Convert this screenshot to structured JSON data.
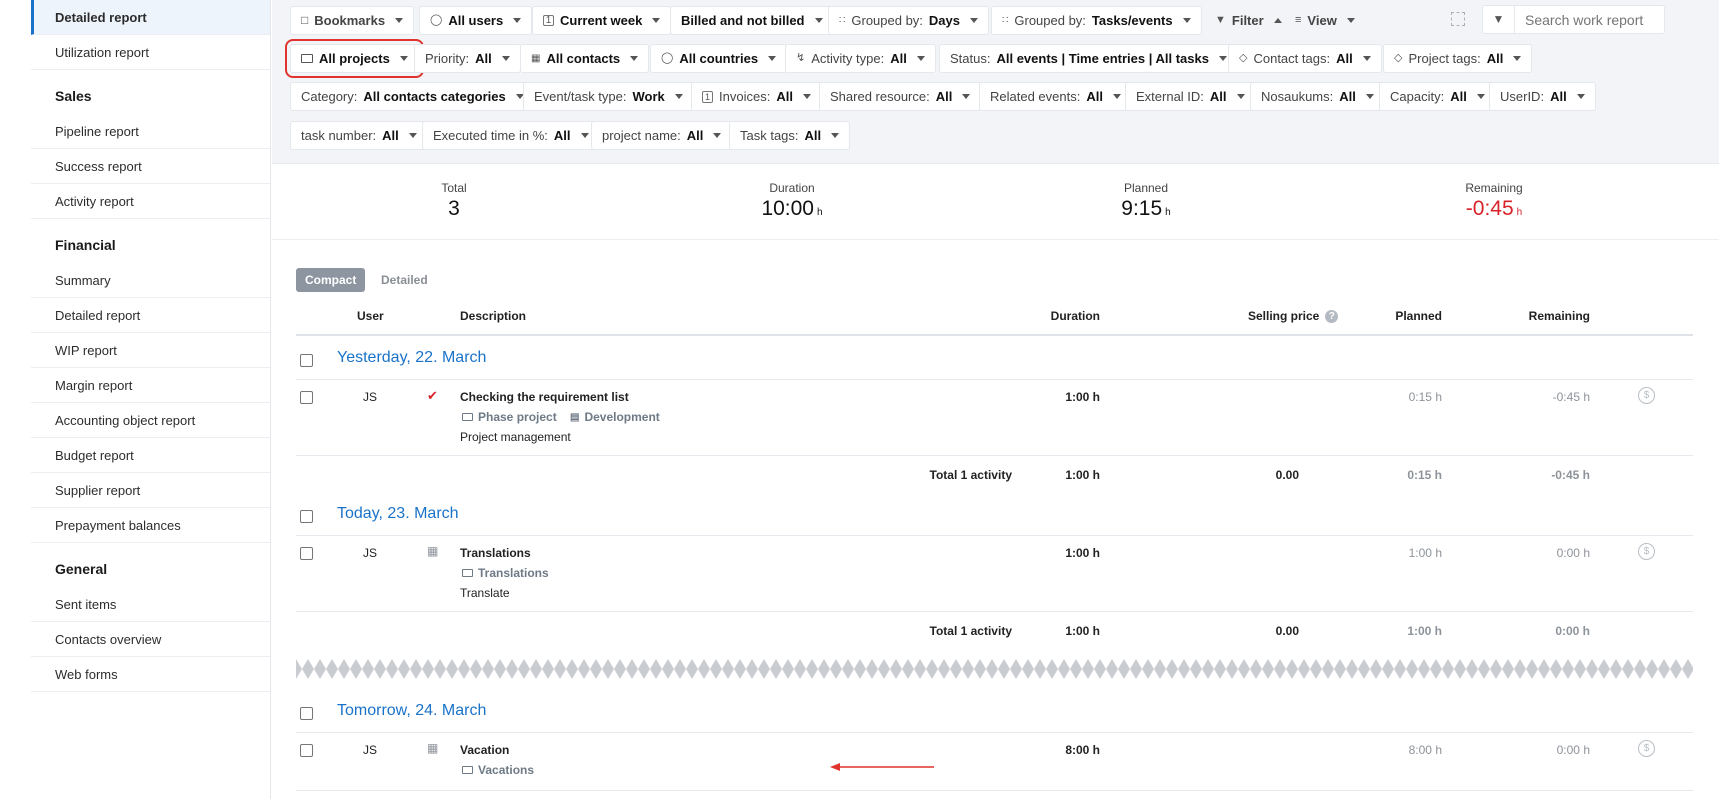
{
  "sidebar": {
    "top_items": [
      "Detailed report",
      "Utilization report"
    ],
    "sales_heading": "Sales",
    "sales_items": [
      "Pipeline report",
      "Success report",
      "Activity report"
    ],
    "financial_heading": "Financial",
    "financial_items": [
      "Summary",
      "Detailed report",
      "WIP report",
      "Margin report",
      "Accounting object report",
      "Budget report",
      "Supplier report",
      "Prepayment balances"
    ],
    "general_heading": "General",
    "general_items": [
      "Sent items",
      "Contacts overview",
      "Web forms"
    ]
  },
  "filters": {
    "row1": {
      "bookmarks": "Bookmarks",
      "users": "All users",
      "period": "Current week",
      "billing": "Billed and not billed",
      "grouped_days_label": "Grouped by: ",
      "grouped_days_value": "Days",
      "grouped_tasks_label": "Grouped by: ",
      "grouped_tasks_value": "Tasks/events",
      "filter": "Filter",
      "view": "View",
      "search_placeholder": "Search work report"
    },
    "row2": {
      "projects": "All projects",
      "priority_label": "Priority: ",
      "priority_value": "All",
      "contacts": "All contacts",
      "countries": "All countries",
      "activity_label": "Activity type: ",
      "activity_value": "All",
      "status_label": "Status: ",
      "status_value": "All events | Time entries | All tasks",
      "contact_tags_label": "Contact tags: ",
      "contact_tags_value": "All",
      "project_tags_label": "Project tags: ",
      "project_tags_value": "All"
    },
    "row3": {
      "category_label": "Category: ",
      "category_value": "All contacts categories",
      "event_type_label": "Event/task type: ",
      "event_type_value": "Work",
      "invoices_label": "Invoices: ",
      "invoices_value": "All",
      "shared_label": "Shared resource: ",
      "shared_value": "All",
      "related_label": "Related events: ",
      "related_value": "All",
      "external_label": "External ID: ",
      "external_value": "All",
      "nosaukums_label": "Nosaukums: ",
      "nosaukums_value": "All",
      "capacity_label": "Capacity: ",
      "capacity_value": "All",
      "userid_label": "UserID: ",
      "userid_value": "All"
    },
    "row4": {
      "task_number_label": "task number: ",
      "task_number_value": "All",
      "executed_label": "Executed time in %: ",
      "executed_value": "All",
      "project_name_label": "project name: ",
      "project_name_value": "All",
      "task_tags_label": "Task tags: ",
      "task_tags_value": "All"
    }
  },
  "summary": {
    "total_label": "Total",
    "total_value": "3",
    "duration_label": "Duration",
    "duration_value": "10:00",
    "planned_label": "Planned",
    "planned_value": "9:15",
    "remaining_label": "Remaining",
    "remaining_value": "-0:45",
    "unit": "h"
  },
  "view_toggle": {
    "compact": "Compact",
    "detailed": "Detailed"
  },
  "table": {
    "headers": {
      "user": "User",
      "description": "Description",
      "duration": "Duration",
      "selling_price": "Selling price",
      "planned": "Planned",
      "remaining": "Remaining",
      "help": "?"
    },
    "groups": [
      {
        "date": "Yesterday, 22. March",
        "row": {
          "user": "JS",
          "title": "Checking the requirement list",
          "project": "Phase project",
          "phase": "Development",
          "activity": "Project management",
          "duration": "1:00 h",
          "planned": "0:15 h",
          "remaining": "-0:45 h"
        },
        "total": {
          "label": "Total 1 activity",
          "duration": "1:00 h",
          "selling_price": "0.00",
          "planned": "0:15 h",
          "remaining": "-0:45 h"
        }
      },
      {
        "date": "Today, 23. March",
        "row": {
          "user": "JS",
          "title": "Translations",
          "project": "Translations",
          "activity": "Translate",
          "duration": "1:00 h",
          "planned": "1:00 h",
          "remaining": "0:00 h"
        },
        "total": {
          "label": "Total 1 activity",
          "duration": "1:00 h",
          "selling_price": "0.00",
          "planned": "1:00 h",
          "remaining": "0:00 h"
        }
      },
      {
        "date": "Tomorrow, 24. March",
        "row": {
          "user": "JS",
          "title": "Vacation",
          "project": "Vacations",
          "duration": "8:00 h",
          "planned": "8:00 h",
          "remaining": "0:00 h"
        }
      }
    ]
  },
  "colors": {
    "accent": "#1a73c9",
    "negative": "#d8232a",
    "highlight": "#e0342f",
    "checkmark": "#d8232a"
  }
}
